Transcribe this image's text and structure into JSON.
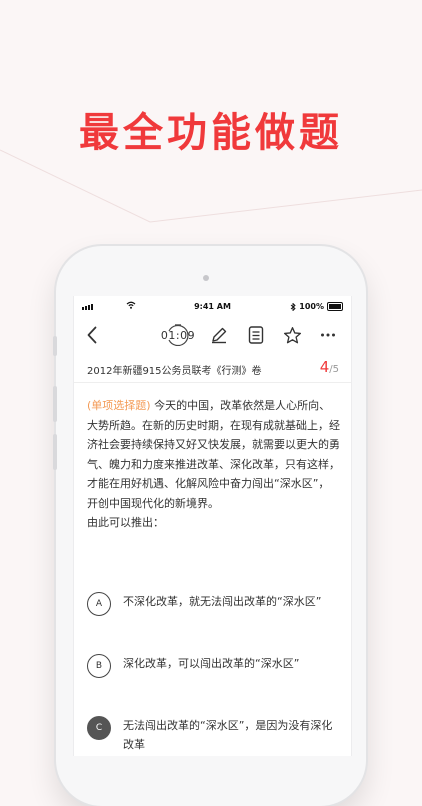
{
  "headline": "最全功能做题",
  "status_bar": {
    "time": "9:41 AM",
    "battery": "100%"
  },
  "toolbar": {
    "timer": "01:09",
    "back_icon": "chevron-left-icon",
    "edit_icon": "pencil-icon",
    "sheet_icon": "answer-sheet-icon",
    "favorite_icon": "star-icon",
    "more_icon": "more-icon"
  },
  "exam": {
    "title": "2012年新疆915公务员联考《行测》卷",
    "current": "4",
    "total": "/5"
  },
  "question": {
    "type_label": "(单项选择题)",
    "stem": "今天的中国，改革依然是人心所向、大势所趋。在新的历史时期，在现有成就基础上，经济社会要持续保持又好又快发展，就需要以更大的勇气、魄力和力度来推进改革、深化改革，只有这样，才能在用好机遇、化解风险中奋力闯出“深水区”，开创中国现代化的新境界。",
    "lead": "由此可以推出："
  },
  "options": [
    {
      "key": "A",
      "text": "不深化改革，就无法闯出改革的“深水区”"
    },
    {
      "key": "B",
      "text": "深化改革，可以闯出改革的“深水区”"
    },
    {
      "key": "C",
      "text": "无法闯出改革的“深水区”，是因为没有深化改革"
    }
  ],
  "colors": {
    "accent": "#f0393b",
    "question_type": "#f39a55",
    "background": "#fbf6f6"
  }
}
